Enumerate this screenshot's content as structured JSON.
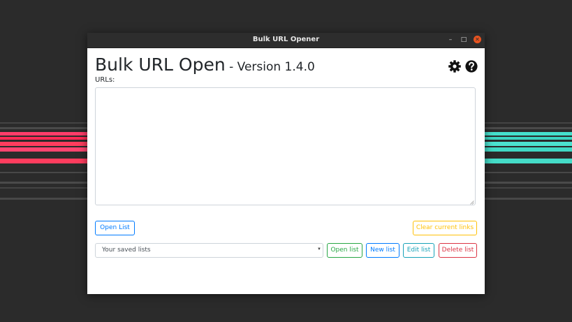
{
  "window": {
    "title": "Bulk URL Opener",
    "controls": {
      "minimize": "–",
      "maximize": "□",
      "close": "✕"
    }
  },
  "header": {
    "app_name": "Bulk URL Open",
    "version": " - Version 1.4.0",
    "icons": [
      "gear-icon",
      "help-icon"
    ]
  },
  "urls": {
    "label": "URLs:",
    "value": "",
    "placeholder": ""
  },
  "buttons": {
    "open_list_file": "Open List",
    "clear_links": "Clear current links",
    "open_list": "Open list",
    "new_list": "New list",
    "edit_list": "Edit list",
    "delete_list": "Delete list"
  },
  "saved_lists": {
    "selected": "Your saved lists"
  },
  "colors": {
    "primary": "#007bff",
    "success": "#28a745",
    "info": "#17a2b8",
    "warning": "#ffc107",
    "danger": "#dc3545",
    "titlebar": "#2d2d2d",
    "close_button": "#e95420"
  }
}
